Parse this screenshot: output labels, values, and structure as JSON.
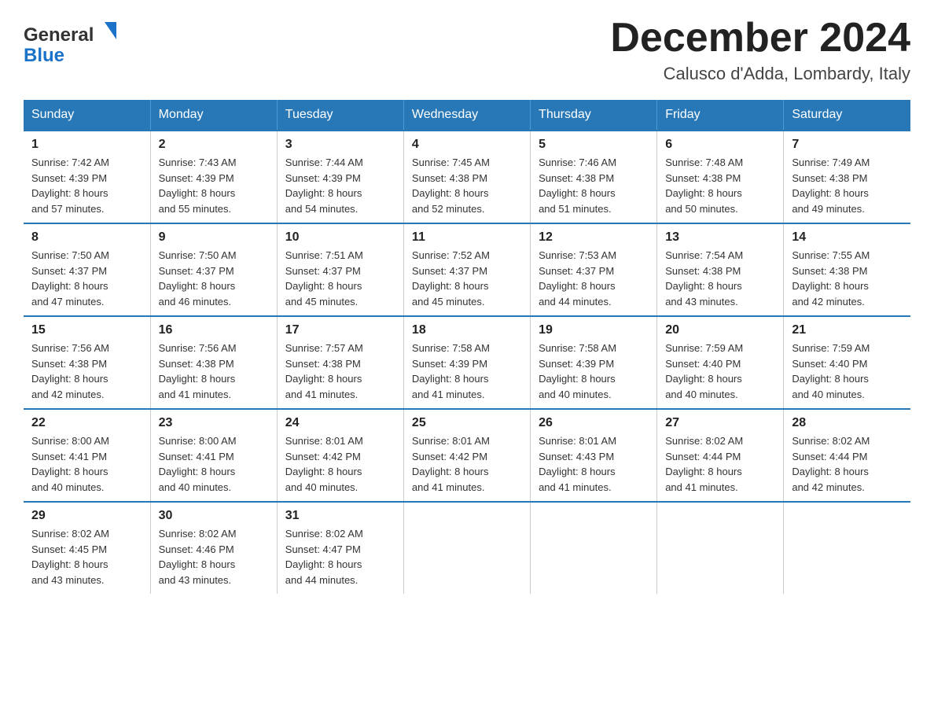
{
  "logo": {
    "general": "General",
    "blue": "Blue"
  },
  "header": {
    "month_year": "December 2024",
    "location": "Calusco d'Adda, Lombardy, Italy"
  },
  "days_of_week": [
    "Sunday",
    "Monday",
    "Tuesday",
    "Wednesday",
    "Thursday",
    "Friday",
    "Saturday"
  ],
  "weeks": [
    [
      {
        "day": "1",
        "sunrise": "7:42 AM",
        "sunset": "4:39 PM",
        "daylight": "8 hours and 57 minutes."
      },
      {
        "day": "2",
        "sunrise": "7:43 AM",
        "sunset": "4:39 PM",
        "daylight": "8 hours and 55 minutes."
      },
      {
        "day": "3",
        "sunrise": "7:44 AM",
        "sunset": "4:39 PM",
        "daylight": "8 hours and 54 minutes."
      },
      {
        "day": "4",
        "sunrise": "7:45 AM",
        "sunset": "4:38 PM",
        "daylight": "8 hours and 52 minutes."
      },
      {
        "day": "5",
        "sunrise": "7:46 AM",
        "sunset": "4:38 PM",
        "daylight": "8 hours and 51 minutes."
      },
      {
        "day": "6",
        "sunrise": "7:48 AM",
        "sunset": "4:38 PM",
        "daylight": "8 hours and 50 minutes."
      },
      {
        "day": "7",
        "sunrise": "7:49 AM",
        "sunset": "4:38 PM",
        "daylight": "8 hours and 49 minutes."
      }
    ],
    [
      {
        "day": "8",
        "sunrise": "7:50 AM",
        "sunset": "4:37 PM",
        "daylight": "8 hours and 47 minutes."
      },
      {
        "day": "9",
        "sunrise": "7:50 AM",
        "sunset": "4:37 PM",
        "daylight": "8 hours and 46 minutes."
      },
      {
        "day": "10",
        "sunrise": "7:51 AM",
        "sunset": "4:37 PM",
        "daylight": "8 hours and 45 minutes."
      },
      {
        "day": "11",
        "sunrise": "7:52 AM",
        "sunset": "4:37 PM",
        "daylight": "8 hours and 45 minutes."
      },
      {
        "day": "12",
        "sunrise": "7:53 AM",
        "sunset": "4:37 PM",
        "daylight": "8 hours and 44 minutes."
      },
      {
        "day": "13",
        "sunrise": "7:54 AM",
        "sunset": "4:38 PM",
        "daylight": "8 hours and 43 minutes."
      },
      {
        "day": "14",
        "sunrise": "7:55 AM",
        "sunset": "4:38 PM",
        "daylight": "8 hours and 42 minutes."
      }
    ],
    [
      {
        "day": "15",
        "sunrise": "7:56 AM",
        "sunset": "4:38 PM",
        "daylight": "8 hours and 42 minutes."
      },
      {
        "day": "16",
        "sunrise": "7:56 AM",
        "sunset": "4:38 PM",
        "daylight": "8 hours and 41 minutes."
      },
      {
        "day": "17",
        "sunrise": "7:57 AM",
        "sunset": "4:38 PM",
        "daylight": "8 hours and 41 minutes."
      },
      {
        "day": "18",
        "sunrise": "7:58 AM",
        "sunset": "4:39 PM",
        "daylight": "8 hours and 41 minutes."
      },
      {
        "day": "19",
        "sunrise": "7:58 AM",
        "sunset": "4:39 PM",
        "daylight": "8 hours and 40 minutes."
      },
      {
        "day": "20",
        "sunrise": "7:59 AM",
        "sunset": "4:40 PM",
        "daylight": "8 hours and 40 minutes."
      },
      {
        "day": "21",
        "sunrise": "7:59 AM",
        "sunset": "4:40 PM",
        "daylight": "8 hours and 40 minutes."
      }
    ],
    [
      {
        "day": "22",
        "sunrise": "8:00 AM",
        "sunset": "4:41 PM",
        "daylight": "8 hours and 40 minutes."
      },
      {
        "day": "23",
        "sunrise": "8:00 AM",
        "sunset": "4:41 PM",
        "daylight": "8 hours and 40 minutes."
      },
      {
        "day": "24",
        "sunrise": "8:01 AM",
        "sunset": "4:42 PM",
        "daylight": "8 hours and 40 minutes."
      },
      {
        "day": "25",
        "sunrise": "8:01 AM",
        "sunset": "4:42 PM",
        "daylight": "8 hours and 41 minutes."
      },
      {
        "day": "26",
        "sunrise": "8:01 AM",
        "sunset": "4:43 PM",
        "daylight": "8 hours and 41 minutes."
      },
      {
        "day": "27",
        "sunrise": "8:02 AM",
        "sunset": "4:44 PM",
        "daylight": "8 hours and 41 minutes."
      },
      {
        "day": "28",
        "sunrise": "8:02 AM",
        "sunset": "4:44 PM",
        "daylight": "8 hours and 42 minutes."
      }
    ],
    [
      {
        "day": "29",
        "sunrise": "8:02 AM",
        "sunset": "4:45 PM",
        "daylight": "8 hours and 43 minutes."
      },
      {
        "day": "30",
        "sunrise": "8:02 AM",
        "sunset": "4:46 PM",
        "daylight": "8 hours and 43 minutes."
      },
      {
        "day": "31",
        "sunrise": "8:02 AM",
        "sunset": "4:47 PM",
        "daylight": "8 hours and 44 minutes."
      },
      null,
      null,
      null,
      null
    ]
  ],
  "labels": {
    "sunrise": "Sunrise:",
    "sunset": "Sunset:",
    "daylight": "Daylight:"
  },
  "accent_color": "#2878b8"
}
